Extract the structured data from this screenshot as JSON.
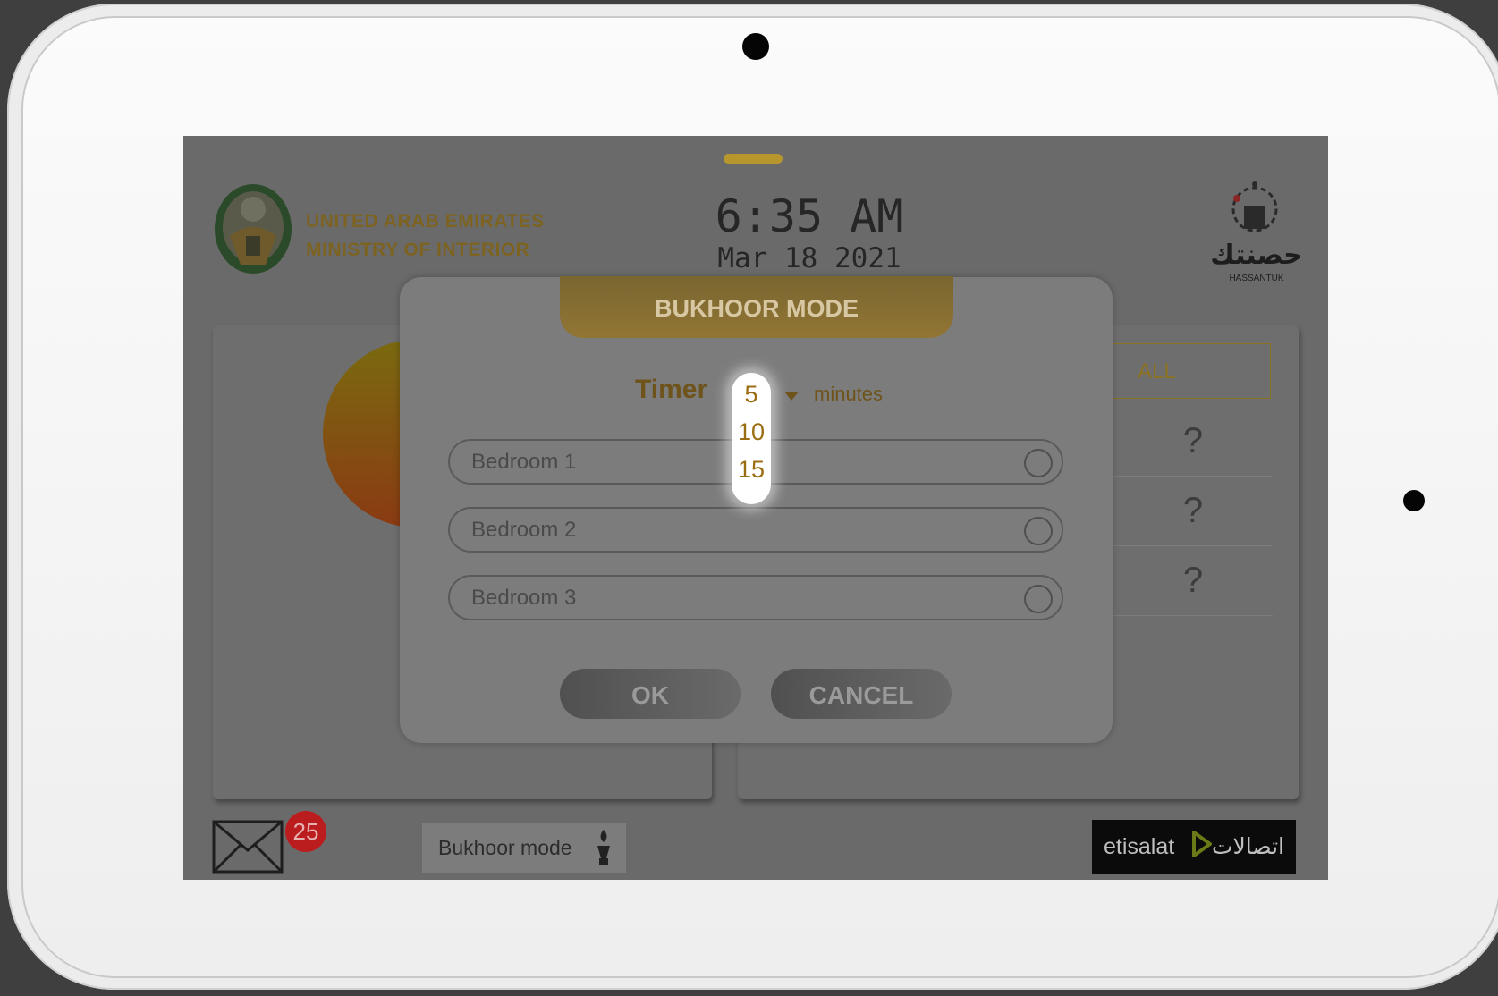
{
  "header": {
    "org_line1": "UNITED ARAB EMIRATES",
    "org_line2": "MINISTRY OF INTERIOR",
    "time": "6:35 AM",
    "date": "Mar 18 2021",
    "brand_arabic": "حصنتك",
    "brand_latin": "HASSANTUK"
  },
  "right_panel": {
    "filter_label": "ALL",
    "rows": [
      "?",
      "?",
      "?"
    ]
  },
  "footer": {
    "message_count": "25",
    "bukhoor_button": "Bukhoor mode",
    "partner_latin": "etisalat",
    "partner_arabic": "اتصالات"
  },
  "dialog": {
    "title": "BUKHOOR MODE",
    "timer_label": "Timer",
    "timer_unit": "minutes",
    "timer_selected": "5",
    "timer_options": [
      "5",
      "10",
      "15"
    ],
    "rooms": [
      "Bedroom 1",
      "Bedroom 2",
      "Bedroom 3"
    ],
    "ok_label": "OK",
    "cancel_label": "CANCEL"
  },
  "colors": {
    "gold_accent": "#b8962e",
    "overlay_gray": "#7c7c7c",
    "badge_red": "#bb1d1f"
  }
}
